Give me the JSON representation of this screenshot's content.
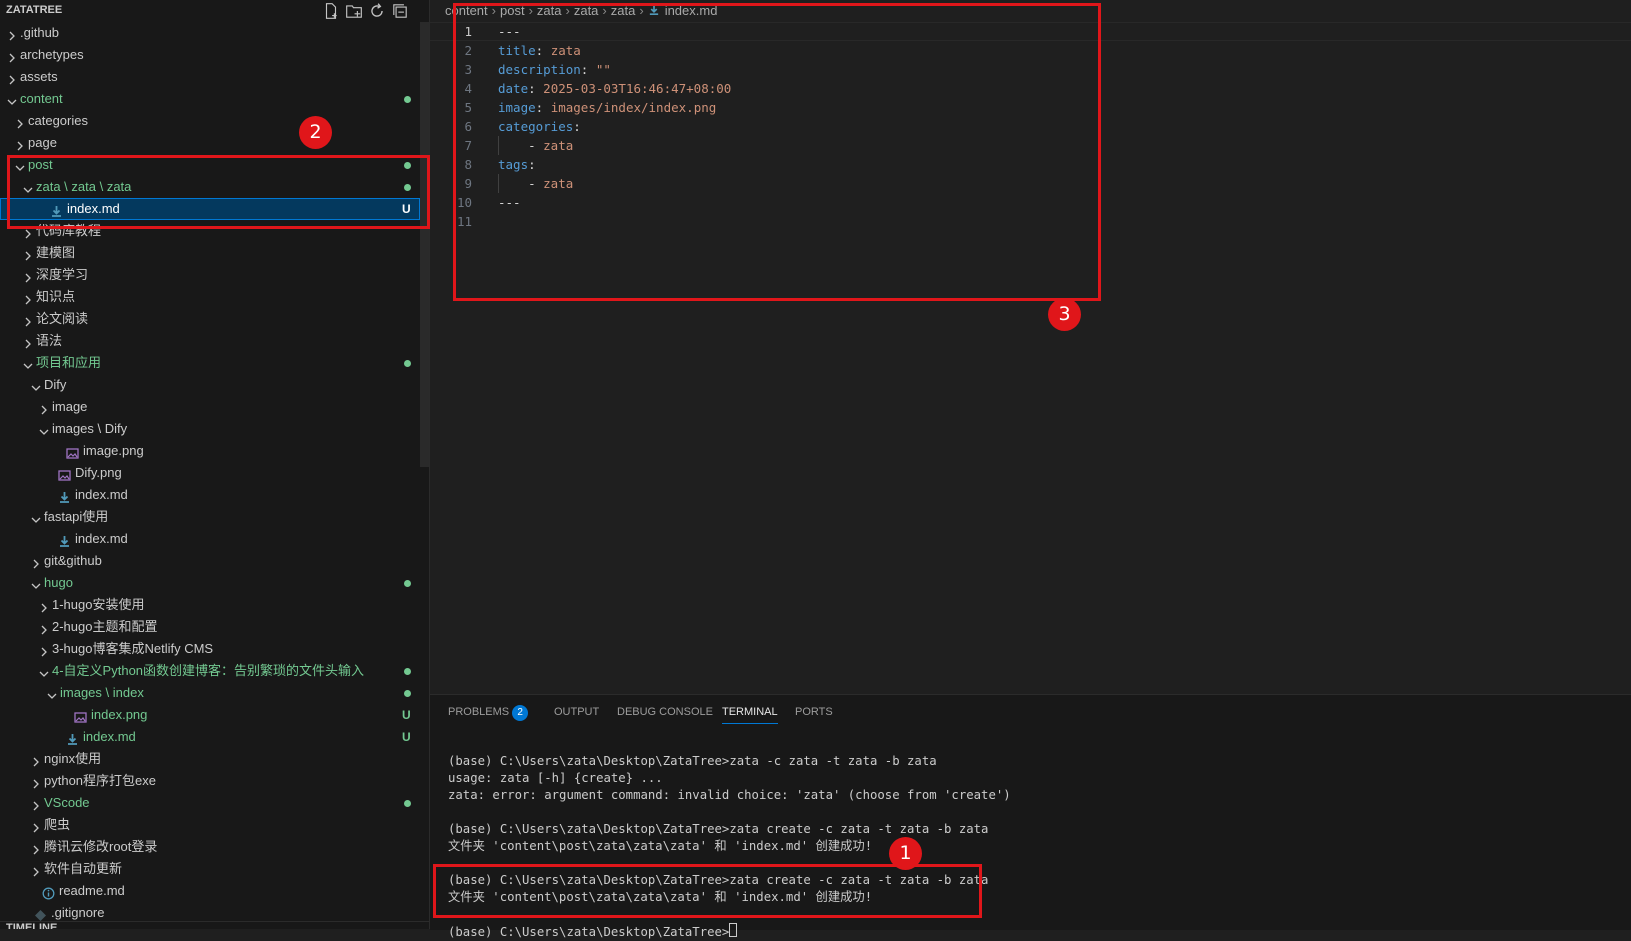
{
  "sidebar": {
    "title": "ZATATREE",
    "actions": [
      {
        "name": "new-file-icon"
      },
      {
        "name": "new-folder-icon"
      },
      {
        "name": "refresh-icon"
      },
      {
        "name": "collapse-all-icon"
      }
    ],
    "tree": [
      {
        "label": ".github",
        "type": "folder",
        "expanded": false,
        "depth": 0
      },
      {
        "label": "archetypes",
        "type": "folder",
        "expanded": false,
        "depth": 0
      },
      {
        "label": "assets",
        "type": "folder",
        "expanded": false,
        "depth": 0
      },
      {
        "label": "content",
        "type": "folder",
        "expanded": true,
        "depth": 0,
        "status": "dot",
        "color": "#73c991"
      },
      {
        "label": "categories",
        "type": "folder",
        "expanded": false,
        "depth": 1
      },
      {
        "label": "page",
        "type": "folder",
        "expanded": false,
        "depth": 1
      },
      {
        "label": "post",
        "type": "folder",
        "expanded": true,
        "depth": 1,
        "status": "dot",
        "color": "#73c991"
      },
      {
        "label": "zata \\ zata \\ zata",
        "type": "folder",
        "expanded": true,
        "depth": 2,
        "status": "dot",
        "color": "#73c991"
      },
      {
        "label": "index.md",
        "type": "md",
        "depth": 3,
        "status": "U",
        "color": "#ffffff",
        "selected": true
      },
      {
        "label": "代码库教程",
        "type": "folder",
        "expanded": false,
        "depth": 2
      },
      {
        "label": "建模图",
        "type": "folder",
        "expanded": false,
        "depth": 2
      },
      {
        "label": "深度学习",
        "type": "folder",
        "expanded": false,
        "depth": 2
      },
      {
        "label": "知识点",
        "type": "folder",
        "expanded": false,
        "depth": 2
      },
      {
        "label": "论文阅读",
        "type": "folder",
        "expanded": false,
        "depth": 2
      },
      {
        "label": "语法",
        "type": "folder",
        "expanded": false,
        "depth": 2
      },
      {
        "label": "项目和应用",
        "type": "folder",
        "expanded": true,
        "depth": 2,
        "status": "dot",
        "color": "#73c991"
      },
      {
        "label": "Dify",
        "type": "folder",
        "expanded": true,
        "depth": 3
      },
      {
        "label": "image",
        "type": "folder",
        "expanded": false,
        "depth": 4
      },
      {
        "label": "images \\ Dify",
        "type": "folder",
        "expanded": true,
        "depth": 4
      },
      {
        "label": "image.png",
        "type": "png",
        "depth": 5
      },
      {
        "label": "Dify.png",
        "type": "png",
        "depth": 4
      },
      {
        "label": "index.md",
        "type": "md",
        "depth": 4
      },
      {
        "label": "fastapi使用",
        "type": "folder",
        "expanded": true,
        "depth": 3
      },
      {
        "label": "index.md",
        "type": "md",
        "depth": 4
      },
      {
        "label": "git&github",
        "type": "folder",
        "expanded": false,
        "depth": 3
      },
      {
        "label": "hugo",
        "type": "folder",
        "expanded": true,
        "depth": 3,
        "status": "dot",
        "color": "#73c991"
      },
      {
        "label": "1-hugo安装使用",
        "type": "folder",
        "expanded": false,
        "depth": 4
      },
      {
        "label": "2-hugo主题和配置",
        "type": "folder",
        "expanded": false,
        "depth": 4
      },
      {
        "label": "3-hugo博客集成Netlify CMS",
        "type": "folder",
        "expanded": false,
        "depth": 4
      },
      {
        "label": "4-自定义Python函数创建博客：告别繁琐的文件头输入",
        "type": "folder",
        "expanded": true,
        "depth": 4,
        "status": "dot",
        "color": "#73c991"
      },
      {
        "label": "images \\ index",
        "type": "folder",
        "expanded": true,
        "depth": 5,
        "status": "dot",
        "color": "#73c991"
      },
      {
        "label": "index.png",
        "type": "png",
        "depth": 6,
        "status": "U",
        "color": "#73c991"
      },
      {
        "label": "index.md",
        "type": "md",
        "depth": 5,
        "status": "U",
        "color": "#73c991"
      },
      {
        "label": "nginx使用",
        "type": "folder",
        "expanded": false,
        "depth": 3
      },
      {
        "label": "python程序打包exe",
        "type": "folder",
        "expanded": false,
        "depth": 3
      },
      {
        "label": "VScode",
        "type": "folder",
        "expanded": false,
        "depth": 3,
        "status": "dot",
        "color": "#73c991"
      },
      {
        "label": "爬虫",
        "type": "folder",
        "expanded": false,
        "depth": 3
      },
      {
        "label": "腾讯云修改root登录",
        "type": "folder",
        "expanded": false,
        "depth": 3
      },
      {
        "label": "软件自动更新",
        "type": "folder",
        "expanded": false,
        "depth": 3
      },
      {
        "label": "readme.md",
        "type": "info",
        "depth": 2
      },
      {
        "label": ".gitignore",
        "type": "git",
        "depth": 1
      }
    ],
    "timeline_label": "TIMELINE"
  },
  "editor": {
    "breadcrumb": [
      "content",
      "post",
      "zata",
      "zata",
      "zata",
      "index.md"
    ],
    "active_line": 1,
    "lines": [
      {
        "n": "1",
        "tokens": [
          {
            "t": "---",
            "c": "p"
          }
        ]
      },
      {
        "n": "2",
        "tokens": [
          {
            "t": "title",
            "c": "k"
          },
          {
            "t": ": ",
            "c": "p"
          },
          {
            "t": "zata",
            "c": "s"
          }
        ]
      },
      {
        "n": "3",
        "tokens": [
          {
            "t": "description",
            "c": "k"
          },
          {
            "t": ": ",
            "c": "p"
          },
          {
            "t": "\"\"",
            "c": "s"
          }
        ]
      },
      {
        "n": "4",
        "tokens": [
          {
            "t": "date",
            "c": "k"
          },
          {
            "t": ": ",
            "c": "p"
          },
          {
            "t": "2025-03-03T16:46:47+08:00",
            "c": "s"
          }
        ]
      },
      {
        "n": "5",
        "tokens": [
          {
            "t": "image",
            "c": "k"
          },
          {
            "t": ": ",
            "c": "p"
          },
          {
            "t": "images/index/index.png",
            "c": "s"
          }
        ]
      },
      {
        "n": "6",
        "tokens": [
          {
            "t": "categories",
            "c": "k"
          },
          {
            "t": ":",
            "c": "p"
          }
        ]
      },
      {
        "n": "7",
        "tokens": [
          {
            "t": "    - ",
            "c": "p"
          },
          {
            "t": "zata",
            "c": "s"
          }
        ]
      },
      {
        "n": "8",
        "tokens": [
          {
            "t": "tags",
            "c": "k"
          },
          {
            "t": ":",
            "c": "p"
          }
        ]
      },
      {
        "n": "9",
        "tokens": [
          {
            "t": "    - ",
            "c": "p"
          },
          {
            "t": "zata",
            "c": "s"
          }
        ]
      },
      {
        "n": "10",
        "tokens": [
          {
            "t": "---",
            "c": "p"
          }
        ]
      },
      {
        "n": "11",
        "tokens": []
      }
    ]
  },
  "panel": {
    "tabs": [
      {
        "label": "PROBLEMS",
        "count": "2",
        "active": false
      },
      {
        "label": "OUTPUT",
        "active": false
      },
      {
        "label": "DEBUG CONSOLE",
        "active": false
      },
      {
        "label": "TERMINAL",
        "active": true
      },
      {
        "label": "PORTS",
        "active": false
      }
    ],
    "terminal_lines": [
      "(base) C:\\Users\\zata\\Desktop\\ZataTree>zata -c zata -t zata -b zata",
      "usage: zata [-h] {create} ...",
      "zata: error: argument command: invalid choice: 'zata' (choose from 'create')",
      "",
      "(base) C:\\Users\\zata\\Desktop\\ZataTree>zata create -c zata -t zata -b zata",
      "文件夹 'content\\post\\zata\\zata\\zata' 和 'index.md' 创建成功!",
      "",
      "(base) C:\\Users\\zata\\Desktop\\ZataTree>zata create -c zata -t zata -b zata",
      "文件夹 'content\\post\\zata\\zata\\zata' 和 'index.md' 创建成功!",
      "",
      "(base) C:\\Users\\zata\\Desktop\\ZataTree>"
    ]
  },
  "annotations": {
    "color": "#e0161a",
    "markers": [
      "1",
      "2",
      "3"
    ]
  }
}
